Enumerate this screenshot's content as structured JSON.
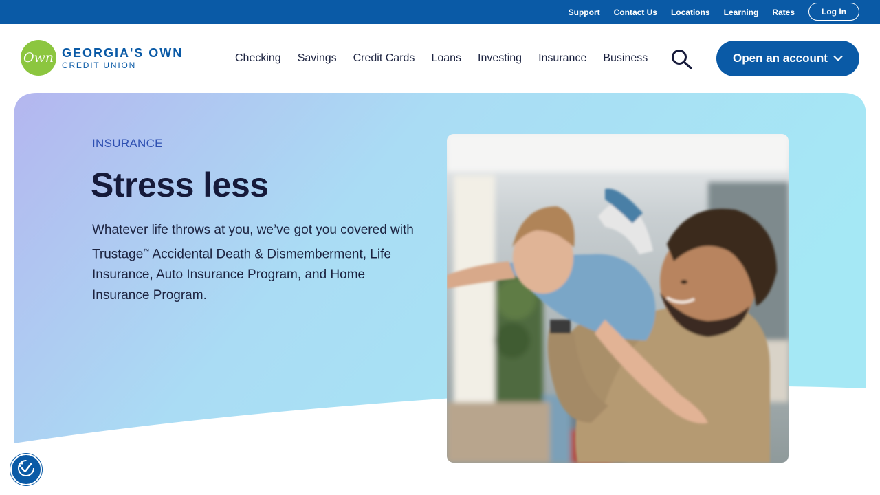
{
  "utility_nav": {
    "links": [
      "Support",
      "Contact Us",
      "Locations",
      "Learning",
      "Rates"
    ],
    "login_label": "Log In"
  },
  "brand": {
    "logo_mark": "Own",
    "name_line1": "GEORGIA'S OWN",
    "name_line2": "CREDIT UNION"
  },
  "main_nav": {
    "items": [
      "Checking",
      "Savings",
      "Credit Cards",
      "Loans",
      "Investing",
      "Insurance",
      "Business"
    ],
    "cta_label": "Open an account"
  },
  "hero": {
    "eyebrow": "INSURANCE",
    "headline": "Stress less",
    "body_before_tm": "Whatever life throws at you, we’ve got you covered with Trustage",
    "tm": "™",
    "body_after_tm": " Accidental Death & Dismemberment, Life Insurance, Auto Insurance Program, and Home Insurance Program."
  },
  "icons": {
    "search": "search-icon",
    "chevron": "chevron-down-icon",
    "accessibility": "accessibility-icon"
  },
  "colors": {
    "primary_blue": "#0a5aa6",
    "brand_green": "#8cc63f",
    "heading_navy": "#161a3a",
    "gradient_start": "#b3b9ef",
    "gradient_end": "#a6e6f5"
  }
}
